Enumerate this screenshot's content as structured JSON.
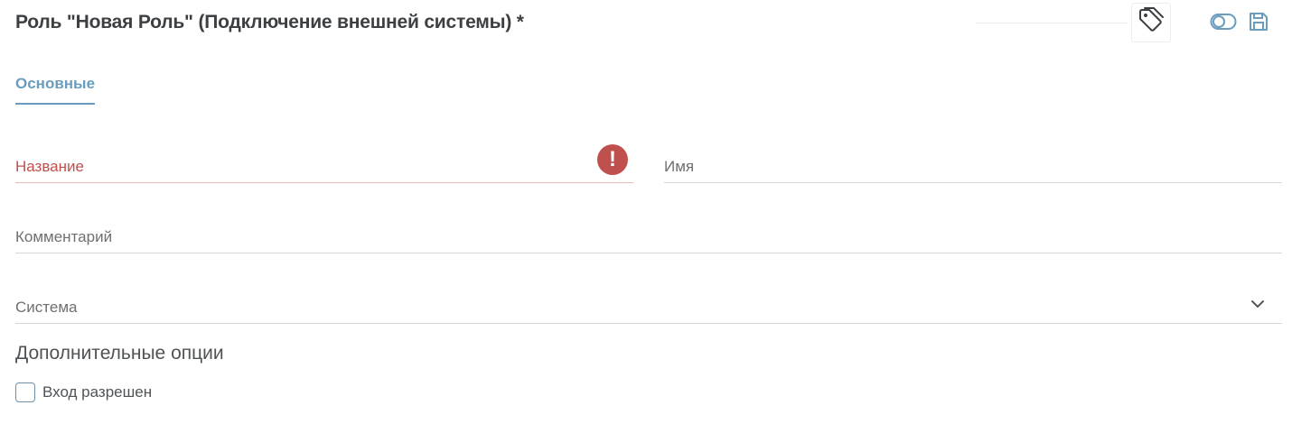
{
  "header": {
    "title": "Роль \"Новая Роль\" (Подключение внешней системы) *",
    "tag_icon": "tag-icon",
    "toggle_icon": "toggle-icon",
    "save_icon": "save-icon"
  },
  "tabs": [
    {
      "label": "Основные",
      "active": true
    }
  ],
  "form": {
    "name_field": {
      "label": "Название",
      "value": "",
      "error": true,
      "error_symbol": "!"
    },
    "login_field": {
      "label": "Имя",
      "value": ""
    },
    "comment_field": {
      "label": "Комментарий",
      "value": ""
    },
    "system_field": {
      "label": "Система",
      "value": ""
    }
  },
  "options": {
    "title": "Дополнительные опции",
    "login_allowed": {
      "label": "Вход разрешен",
      "checked": false
    }
  },
  "colors": {
    "accent": "#6a9dbd",
    "error": "#c0504d",
    "text": "#3d4043"
  }
}
